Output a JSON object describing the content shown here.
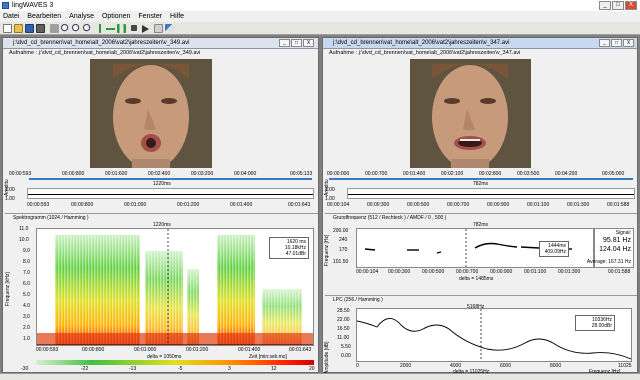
{
  "app": {
    "title": "lingWAVES 3"
  },
  "menu": [
    "Datei",
    "Bearbeiten",
    "Analyse",
    "Optionen",
    "Fenster",
    "Hilfe"
  ],
  "window_buttons": [
    "_",
    "□",
    "X"
  ],
  "left": {
    "title": "j:\\dvd_cd_brennen\\vat_home\\alt_2006\\vat2\\jahreszeiten\\v_349.avi",
    "recording": "Aufnahme : j:\\dvd_cd_brennen\\vat_home\\alt_2006\\vat2\\jahreszeiten\\v_349.avi",
    "timeline_top": [
      "00:00:593",
      "00:00:800",
      "00:01:600",
      "00:02:400",
      "00:03:200",
      "00:04:000",
      "00:05:133"
    ],
    "cursor": "1220ms",
    "waveform_ticks": [
      "1.00",
      "1.00"
    ],
    "waveform_axis": "Amplitu",
    "timeline_bottom": [
      "00:00:593",
      "00:00:800",
      "00:01:000",
      "00:01:200",
      "00:01:400",
      "00:01:643"
    ],
    "spectrogram_title": "Spektrogramm (1024 / Hamming )",
    "spectro_cursor": "1220ms",
    "spectro_yaxis": "Frequenz [kHz]",
    "spectro_yticks": [
      "11.0",
      "10.0",
      "9.0",
      "8.0",
      "7.0",
      "6.0",
      "5.0",
      "4.0",
      "3.0",
      "2.0",
      "1.0"
    ],
    "spectro_xticks": [
      "00:00:593",
      "00:00:800",
      "00:01:000",
      "00:01:200",
      "00:01:400",
      "00:01:643"
    ],
    "spectro_delta": "delta = 1050ms",
    "spectro_unit": "Zeit [min:sek:ms]",
    "spectro_info": [
      "1620 ms",
      "10.18kHz",
      "47.01dBr"
    ],
    "colorscale_ticks": [
      "-30",
      "-22",
      "-13",
      "-5",
      "3",
      "12",
      "20"
    ]
  },
  "right": {
    "title": "j:\\dvd_cd_brennen\\vat_home\\alt_2006\\vat2\\jahreszeiten\\v_347.avi",
    "recording": "Aufnahme : j:\\dvd_cd_brennen\\vat_home\\alt_2006\\vat2\\jahreszeiten\\v_347.avi",
    "timeline_top": [
      "00:00:000",
      "00:00:700",
      "00:01:400",
      "00:02:100",
      "00:02:800",
      "00:03:500",
      "00:04:200",
      "00:05:000"
    ],
    "cursor": "782ms",
    "waveform_ticks": [
      "1.00",
      "1.00"
    ],
    "waveform_axis": "Amplitu",
    "timeline_bottom": [
      "00:00:104",
      "00:00:300",
      "00:00:500",
      "00:00:700",
      "00:00:900",
      "00:01:100",
      "00:01:300",
      "00:01:588"
    ],
    "f0_title": "Grundfrequenz (512 / Rechteck ) / AMDF / 0 , 500 )",
    "f0_cursor": "782ms",
    "f0_yaxis": "Frequenz [Hz]",
    "f0_yticks": [
      "200.00",
      "240",
      "170",
      "101.50"
    ],
    "f0_xticks": [
      "00:00:104",
      "00:00:300",
      "00:00:500",
      "00:00:700",
      "00:00:900",
      "00:01:100",
      "00:01:300",
      "00:01:588"
    ],
    "f0_delta": "delta = 1485ms",
    "f0_info": [
      "1444ms",
      "409.09Hz"
    ],
    "signal": {
      "label": "Signal:",
      "v1": "95.81 Hz",
      "v2": "124.04 Hz",
      "avg": "Average: 167.31 Hz"
    },
    "lpc_title": "LPC (256 / Hamming )",
    "lpc_cursor": "5168Hz",
    "lpc_yaxis": "Amplitude [dB]",
    "lpc_yticks": [
      "28.50",
      "22.00",
      "16.50",
      "11.00",
      "5.50",
      "0.00"
    ],
    "lpc_xticks": [
      "0",
      "2000",
      "4000",
      "6000",
      "8000",
      "11025"
    ],
    "lpc_delta": "delta = 11025Hz",
    "lpc_unit": "Frequenz [Hz]",
    "lpc_info": [
      "10336Hz",
      "28.00dBr"
    ]
  },
  "colors": {
    "accent": "#3a78c8",
    "spectro_high": "#ff2000",
    "spectro_mid": "#ffd000",
    "spectro_low": "#10c040"
  }
}
